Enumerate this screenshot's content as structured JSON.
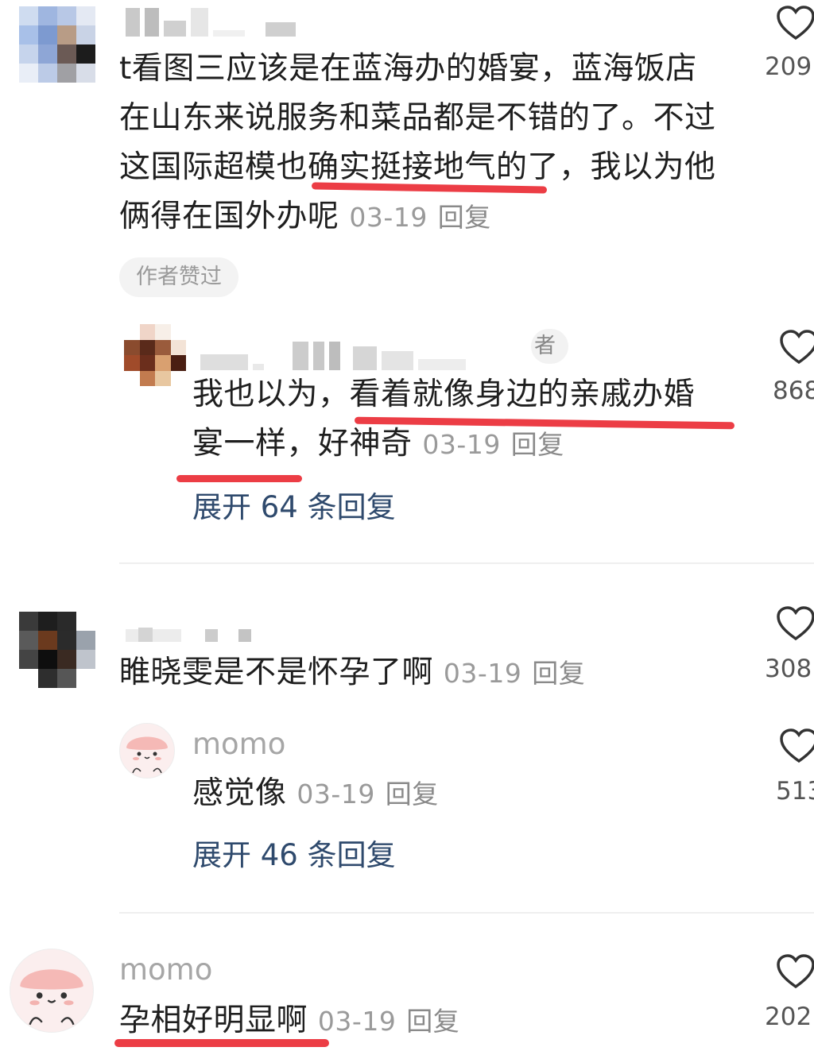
{
  "comments": [
    {
      "text": "t看图三应该是在蓝海办的婚宴，蓝海饭店在山东来说服务和菜品都是不错的了。不过这国际超模也确实挺接地气的了，我以为他俩得在国外办呢",
      "lines": [
        "t看图三应该是在蓝海办的婚宴，蓝海饭店",
        "在山东来说服务和菜品都是不错的了。不过",
        "这国际超模也确实挺接地气的了，我以为他",
        "俩得在国外办呢"
      ],
      "date": "03-19",
      "reply_label": "回复",
      "likes": "209",
      "badge": "作者赞过",
      "reply": {
        "author_suffix": "者",
        "lines": [
          "我也以为，看着就像身边的亲戚办婚",
          "宴一样，好神奇"
        ],
        "date": "03-19",
        "reply_label": "回复",
        "likes": "868",
        "expand": "展开 64 条回复"
      }
    },
    {
      "text": "睢晓雯是不是怀孕了啊",
      "date": "03-19",
      "reply_label": "回复",
      "likes": "308",
      "reply": {
        "author": "momo",
        "text": "感觉像",
        "date": "03-19",
        "reply_label": "回复",
        "likes": "513",
        "expand": "展开 46 条回复"
      }
    },
    {
      "author": "momo",
      "text": "孕相好明显啊",
      "date": "03-19",
      "reply_label": "回复",
      "likes": "202"
    }
  ],
  "icons": {
    "like": "heart-outline-icon"
  },
  "colors": {
    "highlight_underline": "#ec3d45",
    "expand_link": "#2f4a6d",
    "meta_gray": "#9a9a9a"
  }
}
